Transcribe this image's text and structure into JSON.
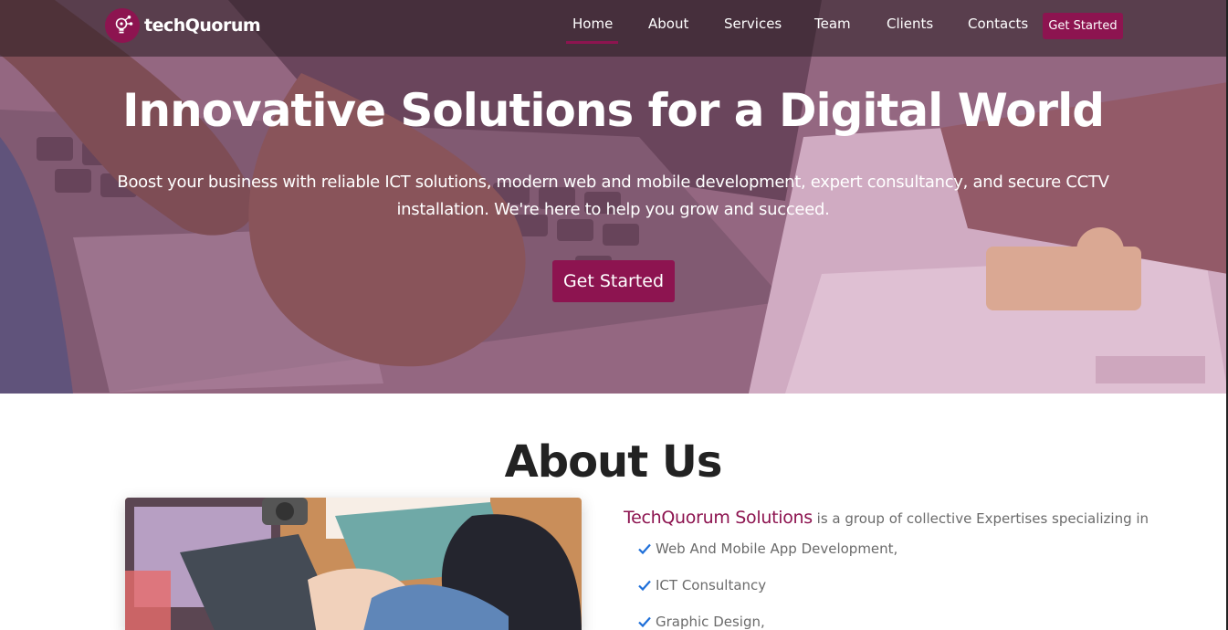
{
  "colors": {
    "accent": "#8d1450",
    "hero_overlay": "#c478aa",
    "check": "#1e6fd9"
  },
  "brand": {
    "name": "techQuorum",
    "logo_icon": "lightbulb-network-icon"
  },
  "nav": {
    "items": [
      {
        "label": "Home",
        "active": true
      },
      {
        "label": "About"
      },
      {
        "label": "Services"
      },
      {
        "label": "Team"
      },
      {
        "label": "Clients"
      },
      {
        "label": "Contacts"
      }
    ],
    "cta_label": "Get Started"
  },
  "hero": {
    "title": "Innovative Solutions for a Digital World",
    "subtitle": "Boost your business with reliable ICT solutions, modern web and mobile development, expert consultancy, and secure CCTV installation. We're here to help you grow and succeed.",
    "cta_label": "Get Started"
  },
  "about": {
    "title": "About Us",
    "company": "TechQuorum Solutions",
    "lead_text": " is a group of collective Expertises specializing in",
    "services": [
      "Web And Mobile App Development,",
      "ICT Consultancy",
      "Graphic Design,"
    ]
  }
}
